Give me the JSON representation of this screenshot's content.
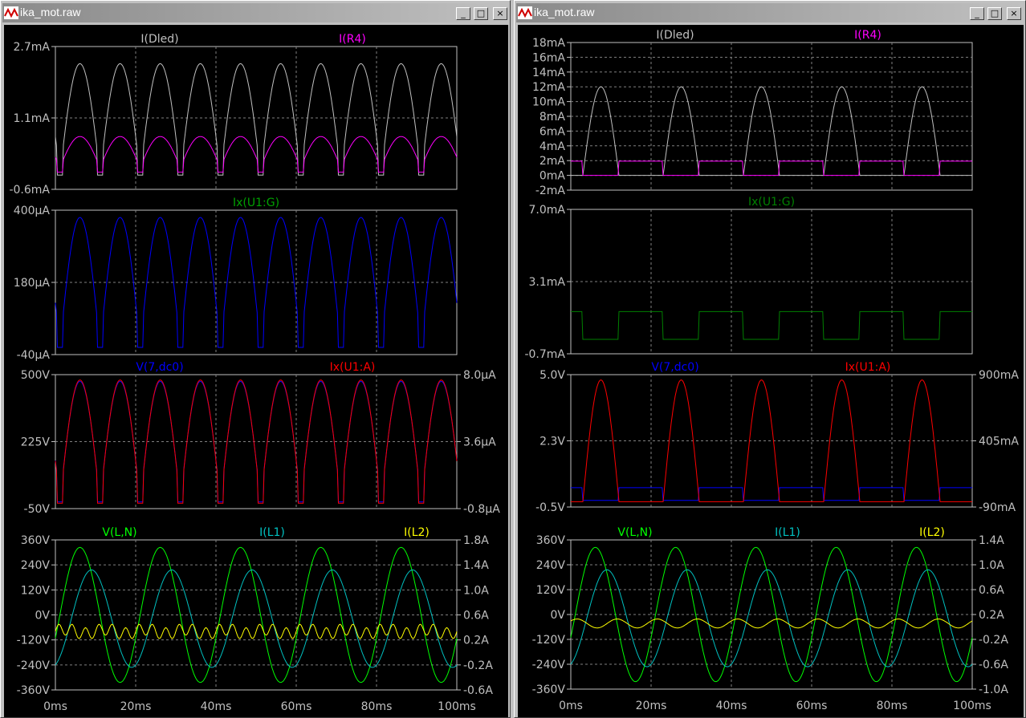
{
  "windows": [
    {
      "title": "ika_mot.raw",
      "buttons": {
        "minimize": "_",
        "maximize": "□",
        "close": "×"
      },
      "chart_data": [
        {
          "type": "line",
          "series": [
            {
              "name": "I(Dled)",
              "color": "#c0c0c0"
            },
            {
              "name": "I(R4)",
              "color": "#ff00ff"
            }
          ],
          "left_ticks": [
            "2.7mA",
            "1.1mA",
            "-0.6mA"
          ],
          "right_ticks": [],
          "ylim": [
            -0.6,
            2.7
          ],
          "ylabel_unit": "mA",
          "grid": true
        },
        {
          "type": "line",
          "series": [
            {
              "name": "Ix(U1:G)",
              "color": "#0000ff",
              "label_color": "#00a000"
            }
          ],
          "left_ticks": [
            "400µA",
            "180µA",
            "-40µA"
          ],
          "right_ticks": [],
          "ylim": [
            -40,
            400
          ],
          "grid": true
        },
        {
          "type": "line",
          "series": [
            {
              "name": "V(7,dc0)",
              "color": "#0000ff"
            },
            {
              "name": "Ix(U1:A)",
              "color": "#ff0000"
            }
          ],
          "left_ticks": [
            "500V",
            "225V",
            "-50V"
          ],
          "right_ticks": [
            "8.0µA",
            "3.6µA",
            "-0.8µA"
          ],
          "ylim": [
            -50,
            500
          ],
          "grid": true
        },
        {
          "type": "line",
          "series": [
            {
              "name": "V(L,N)",
              "color": "#00ff00"
            },
            {
              "name": "I(L1)",
              "color": "#00c0c0"
            },
            {
              "name": "I(L2)",
              "color": "#ffff00"
            }
          ],
          "left_ticks": [
            "360V",
            "240V",
            "120V",
            "0V",
            "-120V",
            "-240V",
            "-360V"
          ],
          "right_ticks": [
            "1.8A",
            "1.4A",
            "1.0A",
            "0.6A",
            "0.2A",
            "-0.2A",
            "-0.6A"
          ],
          "ylim": [
            -360,
            360
          ],
          "grid": true
        }
      ],
      "x_ticks": [
        "0ms",
        "20ms",
        "40ms",
        "60ms",
        "80ms",
        "100ms"
      ],
      "xlim": [
        0,
        100
      ]
    },
    {
      "title": "ika_mot.raw",
      "buttons": {
        "minimize": "_",
        "maximize": "□",
        "close": "×"
      },
      "chart_data": [
        {
          "type": "line",
          "series": [
            {
              "name": "I(Dled)",
              "color": "#c0c0c0"
            },
            {
              "name": "I(R4)",
              "color": "#ff00ff"
            }
          ],
          "left_ticks": [
            "18mA",
            "16mA",
            "14mA",
            "12mA",
            "10mA",
            "8mA",
            "6mA",
            "4mA",
            "2mA",
            "0mA",
            "-2mA"
          ],
          "right_ticks": [],
          "ylim": [
            -2,
            18
          ],
          "grid": true
        },
        {
          "type": "line",
          "series": [
            {
              "name": "Ix(U1:G)",
              "color": "#008000"
            }
          ],
          "left_ticks": [
            "7.0mA",
            "3.1mA",
            "-0.7mA"
          ],
          "right_ticks": [],
          "ylim": [
            -0.7,
            7.0
          ],
          "grid": true
        },
        {
          "type": "line",
          "series": [
            {
              "name": "V(7,dc0)",
              "color": "#0000ff"
            },
            {
              "name": "Ix(U1:A)",
              "color": "#ff0000"
            }
          ],
          "left_ticks": [
            "5.0V",
            "2.3V",
            "-0.5V"
          ],
          "right_ticks": [
            "900mA",
            "405mA",
            "-90mA"
          ],
          "ylim": [
            -0.5,
            5.0
          ],
          "grid": true
        },
        {
          "type": "line",
          "series": [
            {
              "name": "V(L,N)",
              "color": "#00ff00"
            },
            {
              "name": "I(L1)",
              "color": "#00c0c0"
            },
            {
              "name": "I(L2)",
              "color": "#ffff00"
            }
          ],
          "left_ticks": [
            "360V",
            "240V",
            "120V",
            "0V",
            "-120V",
            "-240V",
            "-360V"
          ],
          "right_ticks": [
            "1.4A",
            "1.0A",
            "0.6A",
            "0.2A",
            "-0.2A",
            "-0.6A",
            "-1.0A"
          ],
          "ylim": [
            -360,
            360
          ],
          "grid": true
        }
      ],
      "x_ticks": [
        "0ms",
        "20ms",
        "40ms",
        "60ms",
        "80ms",
        "100ms"
      ],
      "xlim": [
        0,
        100
      ]
    }
  ]
}
